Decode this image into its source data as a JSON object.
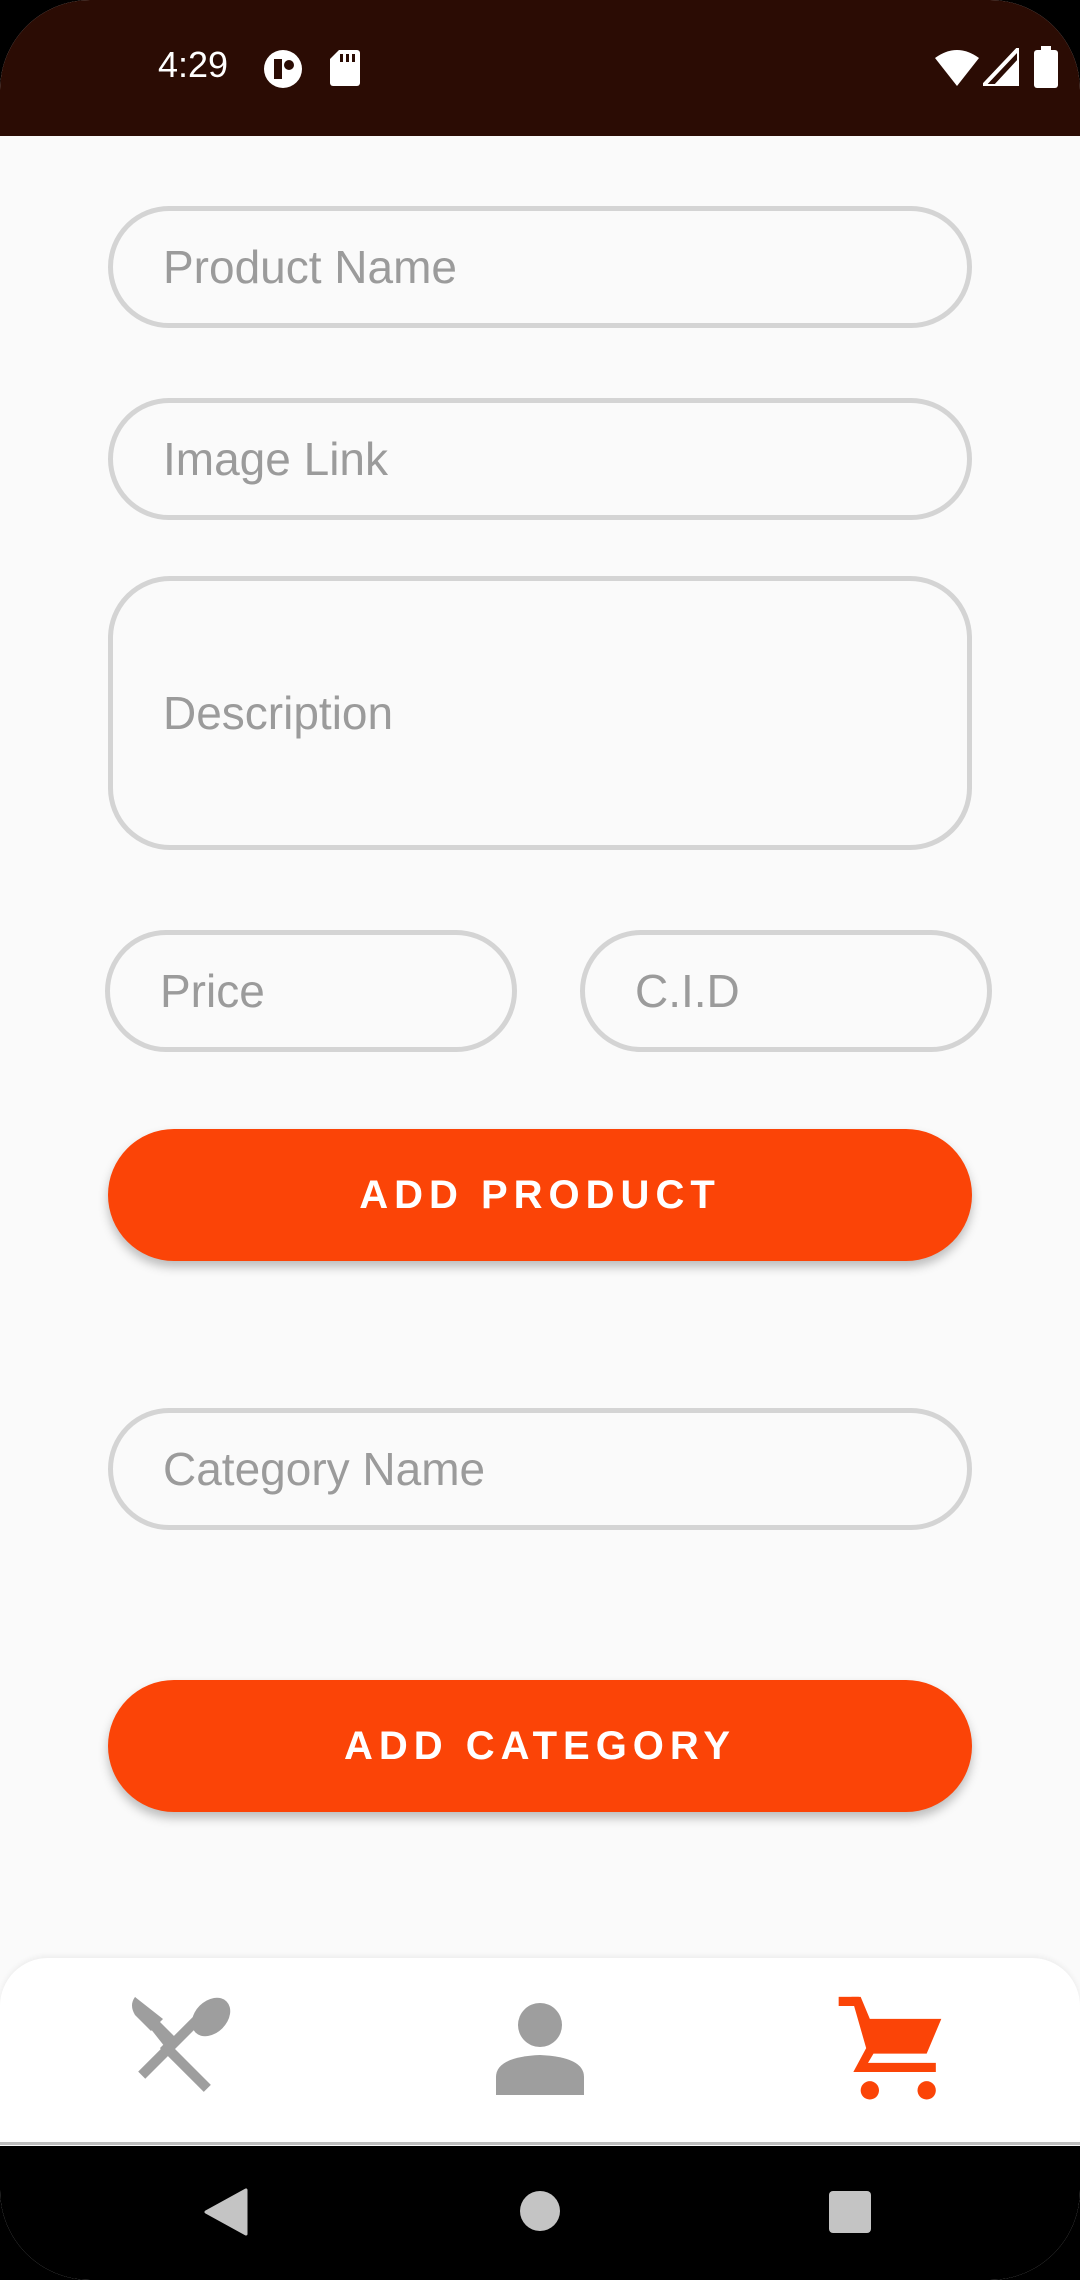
{
  "status_bar": {
    "time": "4:29",
    "icons": [
      "notification-circle-icon",
      "sd-card-icon",
      "wifi-icon",
      "cellular-signal-icon",
      "battery-icon"
    ]
  },
  "form": {
    "product_name_placeholder": "Product Name",
    "image_link_placeholder": "Image Link",
    "description_placeholder": "Description",
    "price_placeholder": "Price",
    "cid_placeholder": "C.I.D",
    "add_product_label": "ADD PRODUCT",
    "category_name_placeholder": "Category Name",
    "add_category_label": "ADD CATEGORY"
  },
  "bottom_nav": {
    "items": [
      {
        "icon": "utensils-icon",
        "active": false
      },
      {
        "icon": "person-icon",
        "active": false
      },
      {
        "icon": "cart-icon",
        "active": true
      }
    ]
  },
  "colors": {
    "accent": "#fb4407",
    "status_bar_bg": "#2b0c04",
    "inactive_icon": "#9e9e9e"
  }
}
